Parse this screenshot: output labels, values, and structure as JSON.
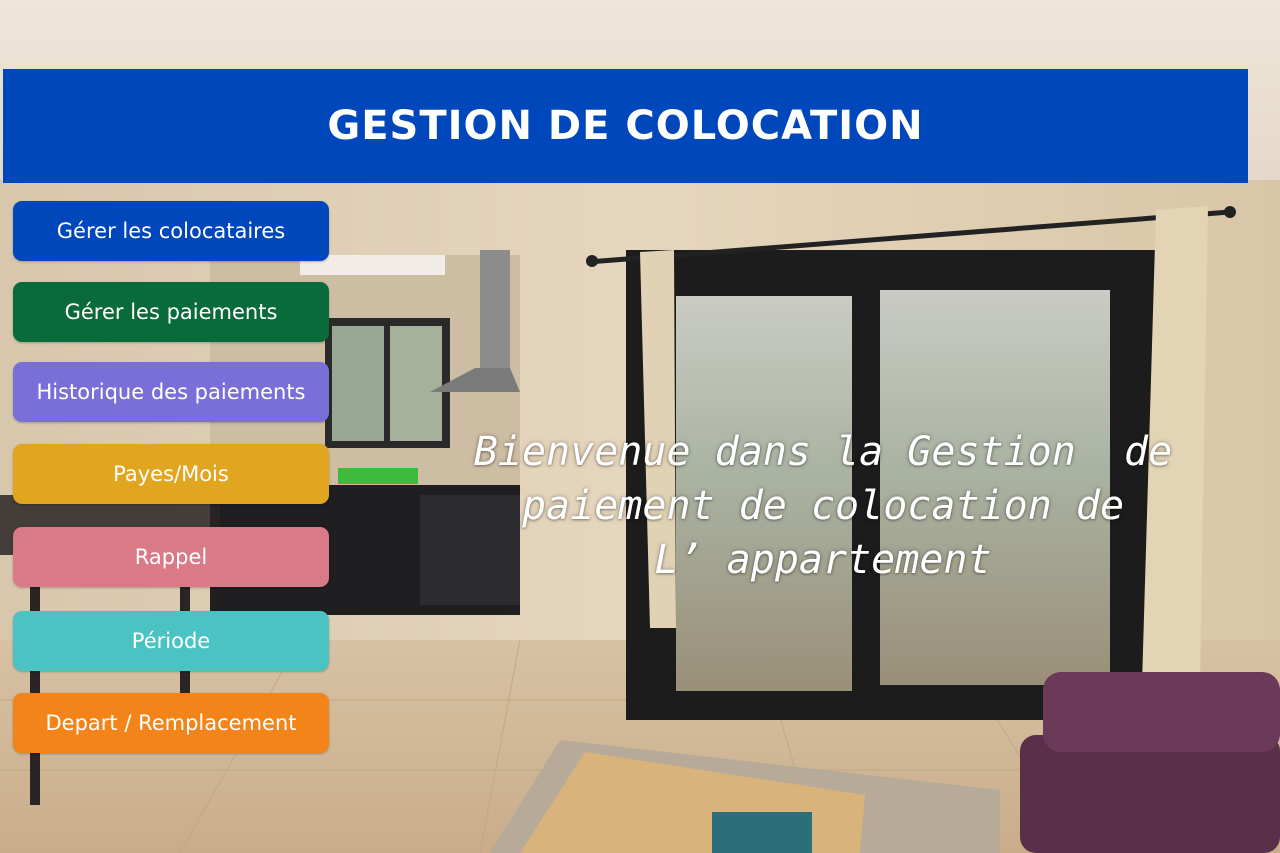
{
  "header": {
    "title": "GESTION DE COLOCATION"
  },
  "menu": {
    "items": [
      {
        "label": "Gérer les colocataires",
        "color": "#0047bb"
      },
      {
        "label": "Gérer les paiements",
        "color": "#0a6b3a"
      },
      {
        "label": "Historique des paiements",
        "color": "#7a6fd9"
      },
      {
        "label": "Payes/Mois",
        "color": "#e2a520"
      },
      {
        "label": "Rappel",
        "color": "#d97a86"
      },
      {
        "label": "Période",
        "color": "#4cc3c3"
      },
      {
        "label": "Depart / Remplacement",
        "color": "#f2841a"
      }
    ]
  },
  "welcome": {
    "lines": [
      "Bienvenue dans la Gestion  de",
      "paiement de colocation de",
      "L’ appartement"
    ]
  }
}
